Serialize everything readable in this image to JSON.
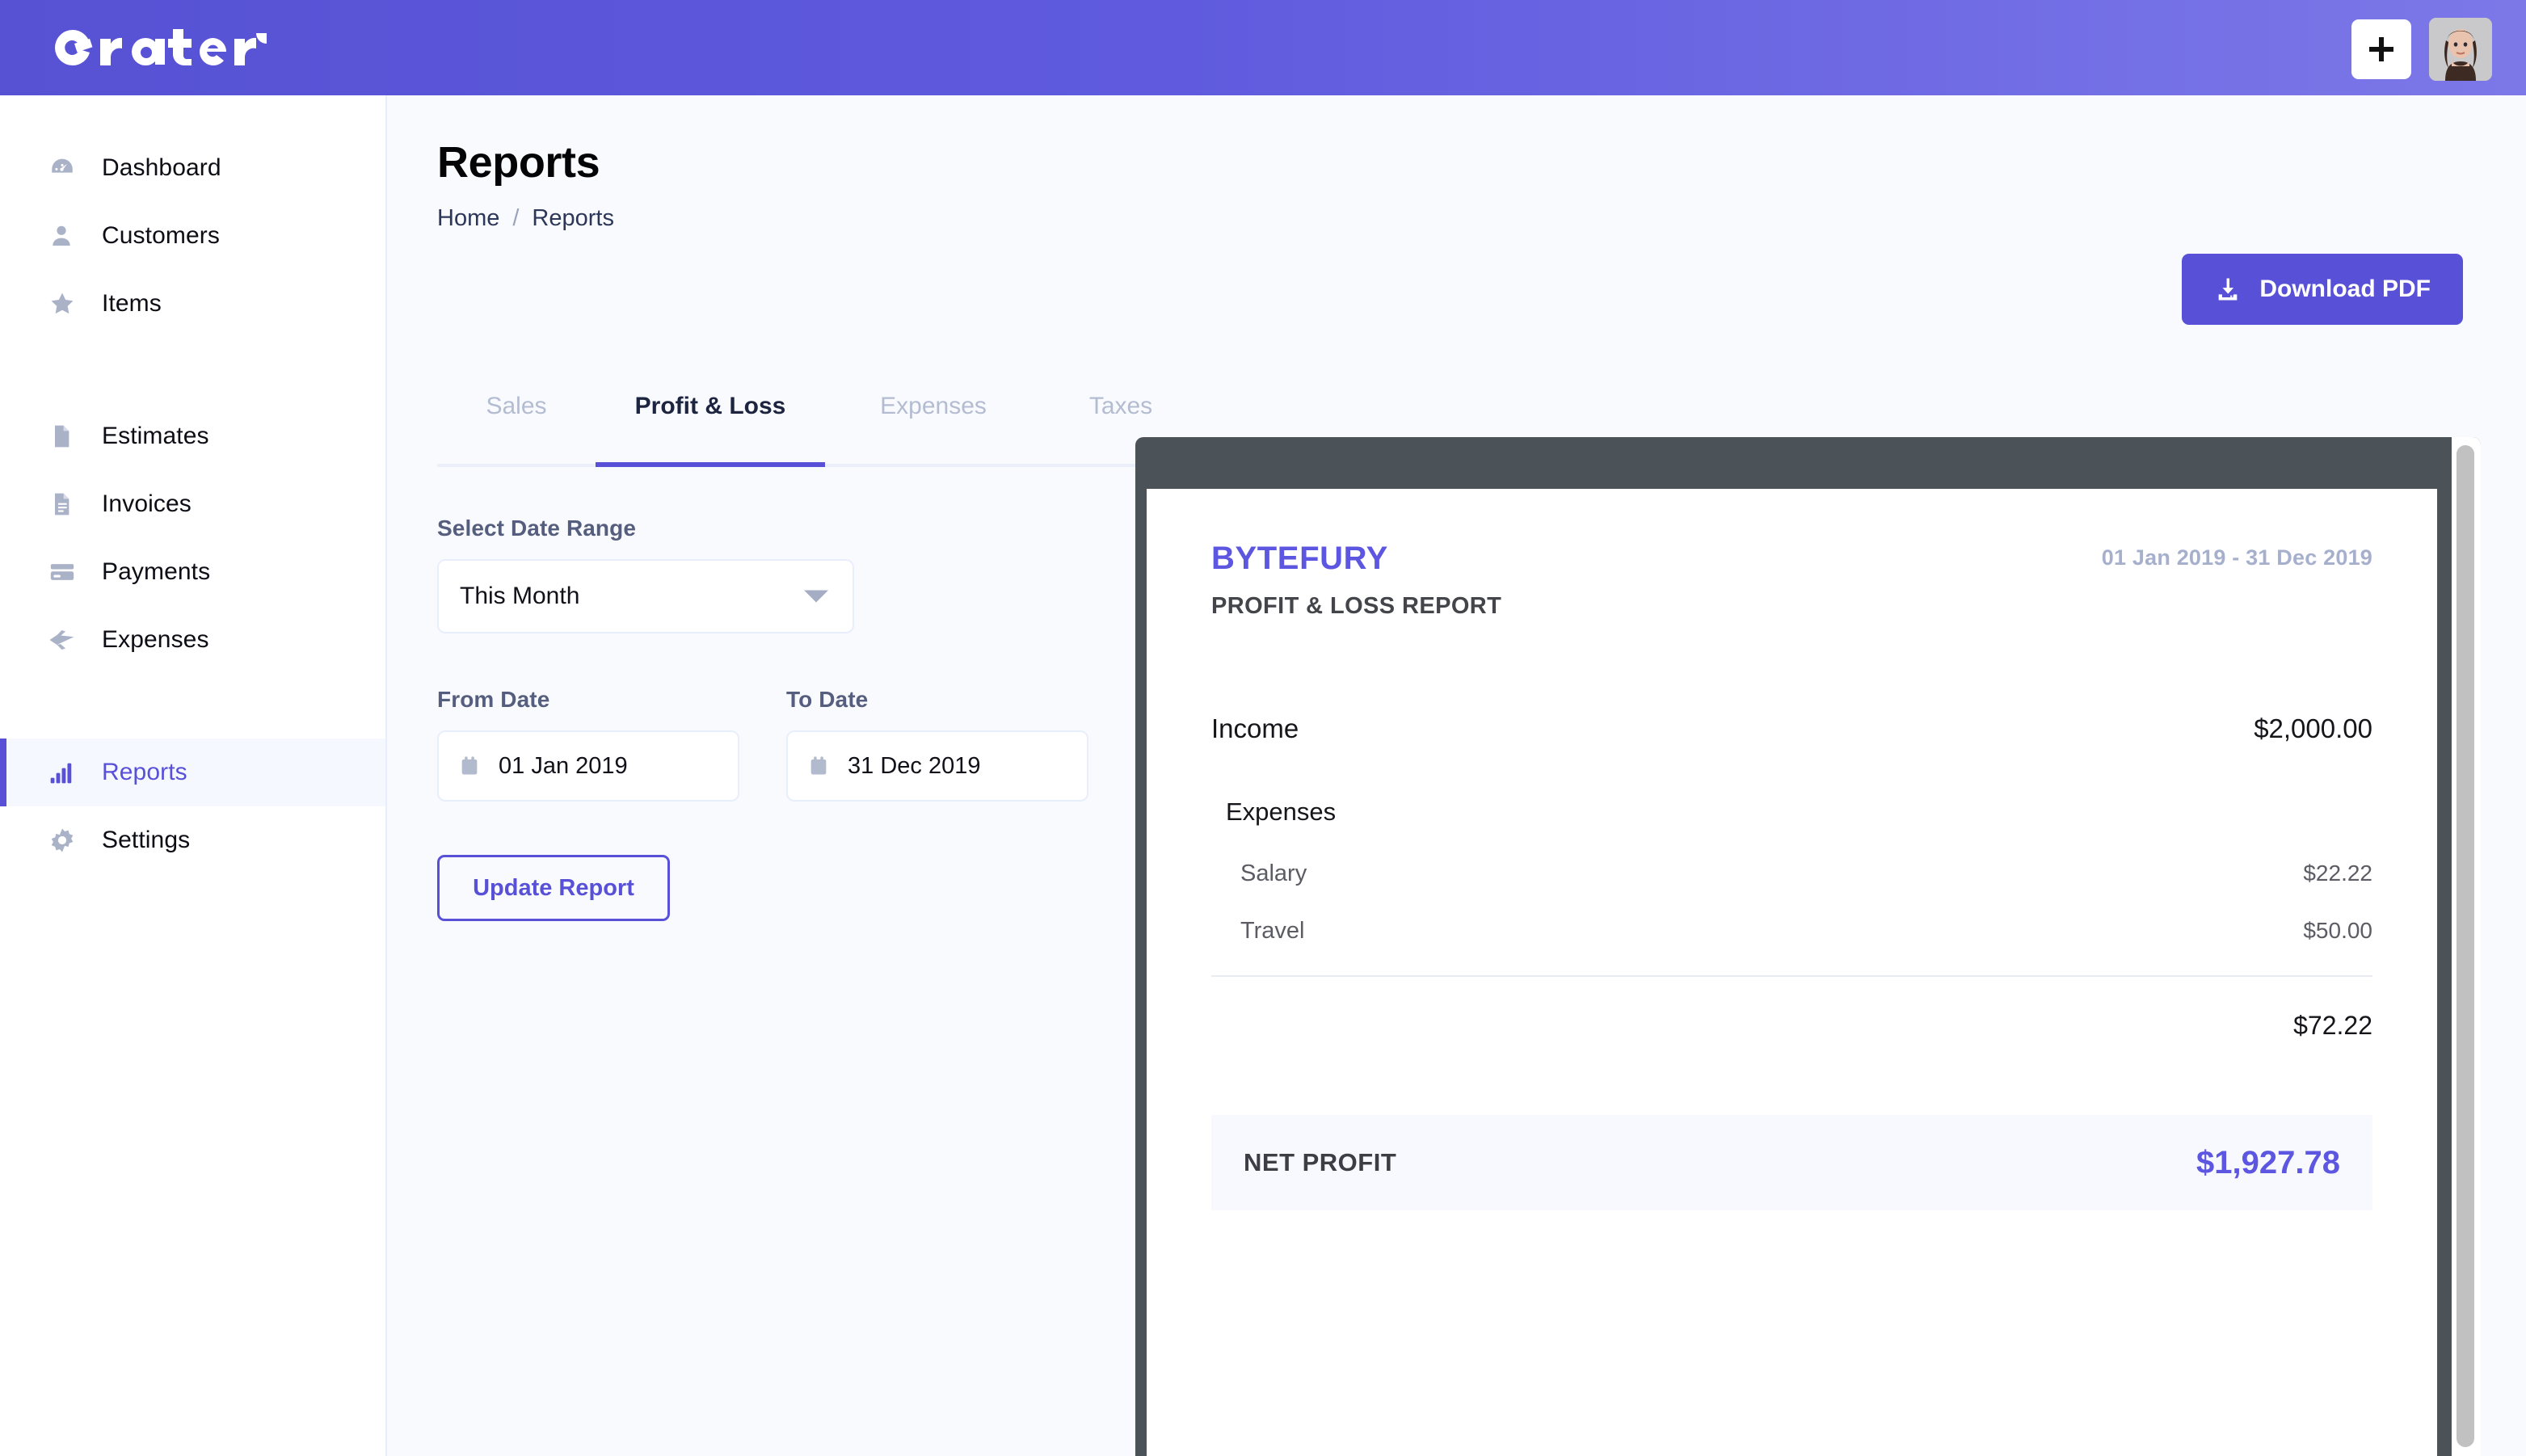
{
  "app": {
    "brand": "crater",
    "accent": "#5851d8",
    "topbar_gradient_from": "#5752d4",
    "topbar_gradient_to": "#7c78e8"
  },
  "topbar": {
    "add_button_label": "+",
    "add_icon": "plus-icon",
    "avatar_label": "User avatar"
  },
  "sidebar": {
    "items": [
      {
        "label": "Dashboard",
        "icon": "dashboard-gauge-icon",
        "active": false
      },
      {
        "label": "Customers",
        "icon": "user-icon",
        "active": false
      },
      {
        "label": "Items",
        "icon": "star-icon",
        "active": false
      },
      {
        "label": "Estimates",
        "icon": "document-icon",
        "active": false
      },
      {
        "label": "Invoices",
        "icon": "invoice-document-icon",
        "active": false
      },
      {
        "label": "Payments",
        "icon": "credit-card-icon",
        "active": false
      },
      {
        "label": "Expenses",
        "icon": "paper-plane-icon",
        "active": false
      },
      {
        "label": "Reports",
        "icon": "bar-chart-icon",
        "active": true
      },
      {
        "label": "Settings",
        "icon": "gear-icon",
        "active": false
      }
    ]
  },
  "header": {
    "title": "Reports",
    "breadcrumb": [
      {
        "label": "Home"
      },
      {
        "label": "Reports"
      }
    ],
    "breadcrumb_separator": "/",
    "download_button": {
      "label": "Download PDF",
      "icon": "download-icon"
    }
  },
  "tabs": [
    {
      "label": "Sales",
      "active": false
    },
    {
      "label": "Profit & Loss",
      "active": true
    },
    {
      "label": "Expenses",
      "active": false
    },
    {
      "label": "Taxes",
      "active": false
    }
  ],
  "filters": {
    "date_range_label": "Select Date Range",
    "date_range_value": "This Month",
    "date_range_icon": "chevron-down-icon",
    "from_date_label": "From Date",
    "from_date_value": "01 Jan 2019",
    "to_date_label": "To Date",
    "to_date_value": "31 Dec 2019",
    "calendar_icon": "calendar-icon",
    "update_button_label": "Update Report"
  },
  "report": {
    "company": "BYTEFURY",
    "subtitle": "PROFIT & LOSS REPORT",
    "date_range": "01 Jan 2019 - 31 Dec 2019",
    "income_label": "Income",
    "income_value": "$2,000.00",
    "expenses_label": "Expenses",
    "expense_rows": [
      {
        "label": "Salary",
        "value": "$22.22"
      },
      {
        "label": "Travel",
        "value": "$50.00"
      }
    ],
    "expenses_total": "$72.22",
    "net_profit_label": "NET PROFIT",
    "net_profit_value": "$1,927.78",
    "net_profit_color": "#5c56e0"
  }
}
